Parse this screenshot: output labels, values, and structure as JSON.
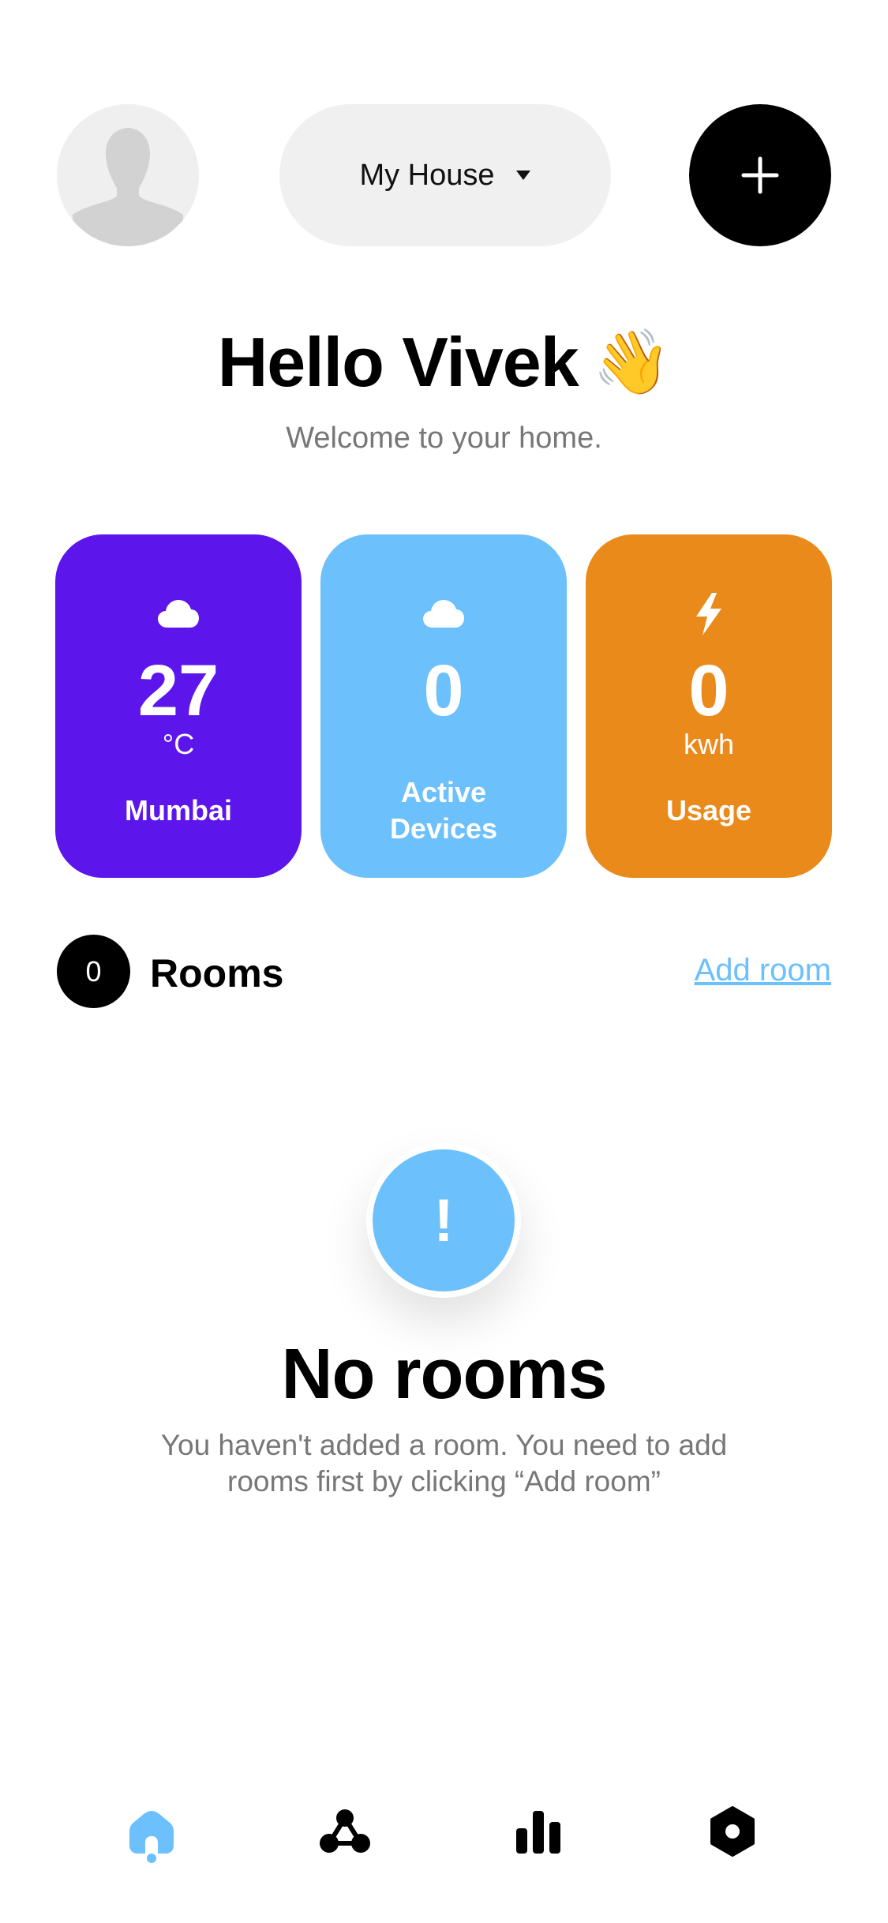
{
  "header": {
    "avatar_icon": "user-silhouette-icon",
    "house_selector": {
      "label": "My House",
      "icon": "caret-down-icon"
    },
    "add_button_icon": "plus-icon"
  },
  "greeting": {
    "title": "Hello Vivek",
    "emoji": "👋",
    "subtitle": "Welcome to your home."
  },
  "stats": [
    {
      "icon": "cloud-icon",
      "value": "27",
      "unit": "°C",
      "label": "Mumbai",
      "color": "#5c16ec"
    },
    {
      "icon": "cloud-icon",
      "value": "0",
      "unit": "",
      "label": "Active Devices",
      "color": "#6cc0fb"
    },
    {
      "icon": "lightning-icon",
      "value": "0",
      "unit": "kwh",
      "label": "Usage",
      "color": "#ea8a1a"
    }
  ],
  "rooms": {
    "count": "0",
    "title": "Rooms",
    "add_link": "Add room"
  },
  "empty_state": {
    "icon_text": "!",
    "title": "No rooms",
    "description": "You haven't added a room. You need to add rooms first by clicking “Add room”"
  },
  "bottom_nav": [
    {
      "icon": "home-icon",
      "active": true
    },
    {
      "icon": "devices-network-icon",
      "active": false
    },
    {
      "icon": "bar-chart-icon",
      "active": false
    },
    {
      "icon": "settings-hexagon-icon",
      "active": false
    }
  ],
  "colors": {
    "accent": "#6cc0fb",
    "purple": "#5c16ec",
    "orange": "#ea8a1a"
  }
}
